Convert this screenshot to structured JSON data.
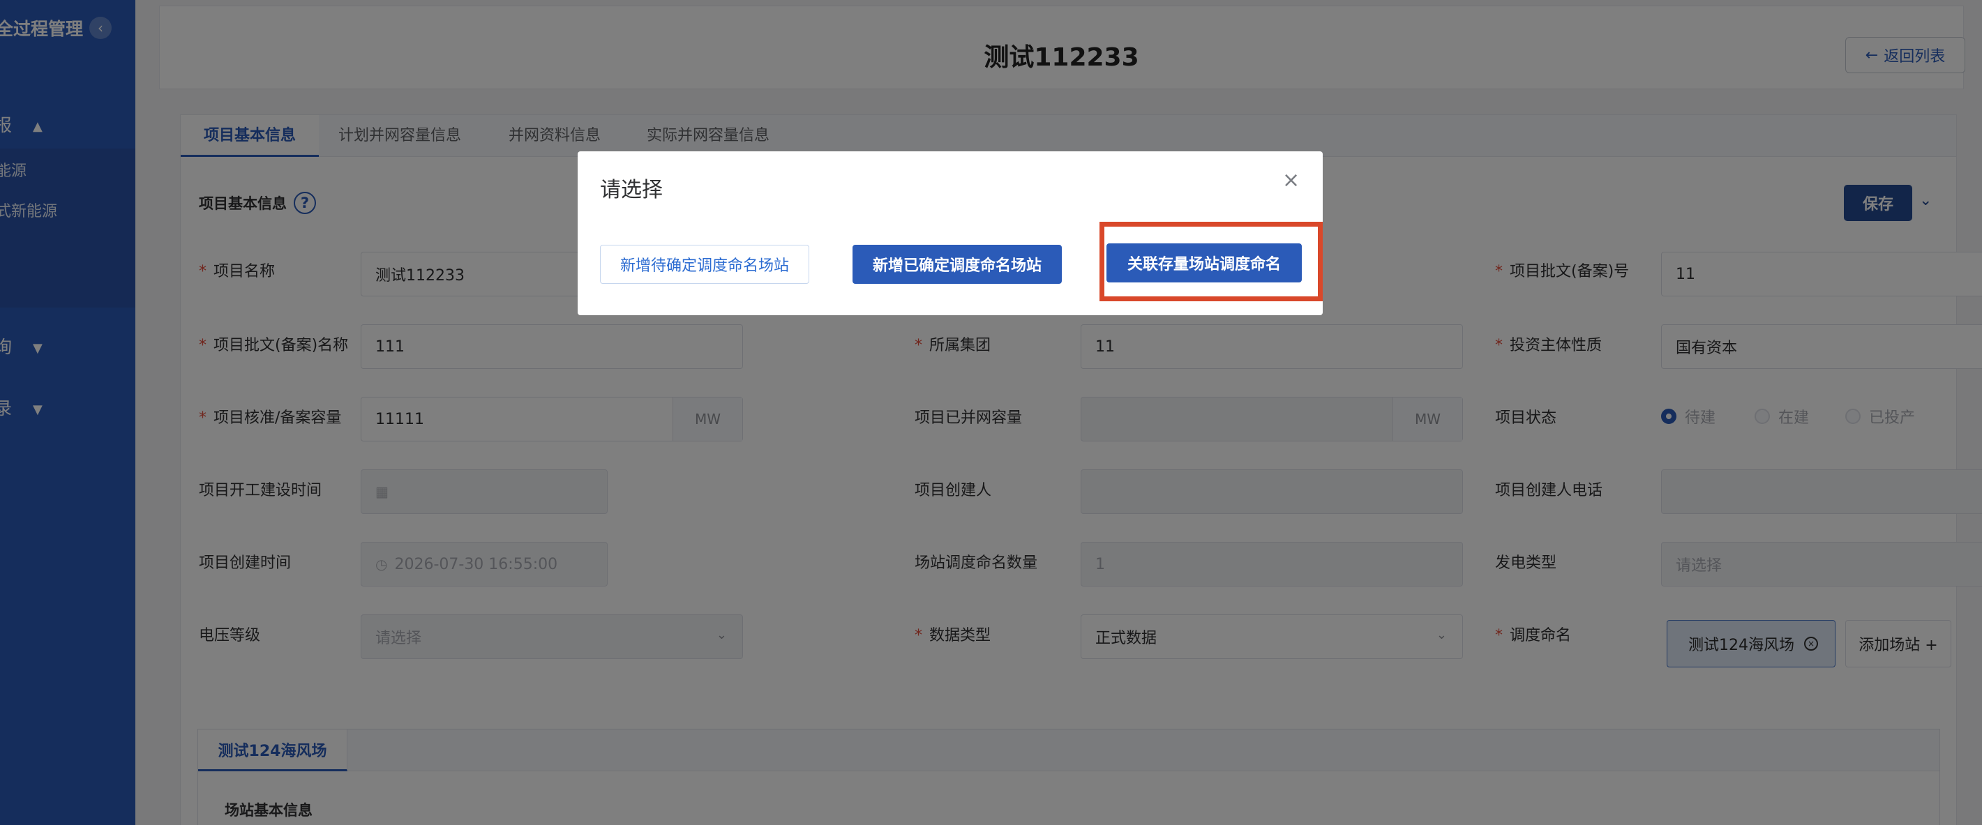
{
  "sidebar": {
    "title": "全过程管理",
    "collapse_icon": "‹",
    "groups": [
      {
        "label": "报",
        "arrow": "▲"
      },
      {
        "label": "询",
        "arrow": "▼"
      },
      {
        "label": "录",
        "arrow": "▼"
      }
    ],
    "subitems": [
      "能源",
      "式新能源"
    ]
  },
  "header": {
    "title": "测试112233",
    "back_label": "返回列表",
    "back_icon": "←"
  },
  "tabs": [
    "项目基本信息",
    "计划并网容量信息",
    "并网资料信息",
    "实际并网容量信息"
  ],
  "section": {
    "title": "项目基本信息",
    "help_icon": "?",
    "save_label": "保存",
    "save_caret": "⌄"
  },
  "form": {
    "project_name": {
      "label": "项目名称",
      "value": "测试112233"
    },
    "approval_no": {
      "label": "项目批文(备案)号",
      "value": "11"
    },
    "approval_name": {
      "label": "项目批文(备案)名称",
      "value": "111"
    },
    "group": {
      "label": "所属集团",
      "value": "11"
    },
    "investor_type": {
      "label": "投资主体性质",
      "value": "国有资本"
    },
    "approved_capacity": {
      "label": "项目核准/备案容量",
      "value": "11111",
      "unit": "MW"
    },
    "connected_capacity": {
      "label": "项目已并网容量",
      "value": "",
      "unit": "MW"
    },
    "status": {
      "label": "项目状态",
      "options": [
        "待建",
        "在建",
        "已投产"
      ],
      "selected": "待建"
    },
    "start_time": {
      "label": "项目开工建设时间",
      "value": ""
    },
    "creator": {
      "label": "项目创建人",
      "value": ""
    },
    "creator_phone": {
      "label": "项目创建人电话",
      "value": ""
    },
    "create_time": {
      "label": "项目创建时间",
      "value": "2026-07-30 16:55:00"
    },
    "station_count": {
      "label": "场站调度命名数量",
      "value": "1"
    },
    "gen_type": {
      "label": "发电类型",
      "placeholder": "请选择"
    },
    "voltage": {
      "label": "电压等级",
      "placeholder": "请选择"
    },
    "data_type": {
      "label": "数据类型",
      "value": "正式数据"
    },
    "dispatch_name": {
      "label": "调度命名",
      "tag": "测试124海风场",
      "add_label": "添加场站 +"
    }
  },
  "station_tabs": [
    "测试124海风场"
  ],
  "station_section_title": "场站基本信息",
  "dialog": {
    "title": "请选择",
    "close_icon": "×",
    "buttons": [
      "新增待确定调度命名场站",
      "新增已确定调度命名场站",
      "关联存量场站调度命名"
    ]
  },
  "colors": {
    "sidebar": "#2b5bb8",
    "primary": "#2b5bb8",
    "highlight": "#d9482a",
    "required": "#e24c3b"
  }
}
